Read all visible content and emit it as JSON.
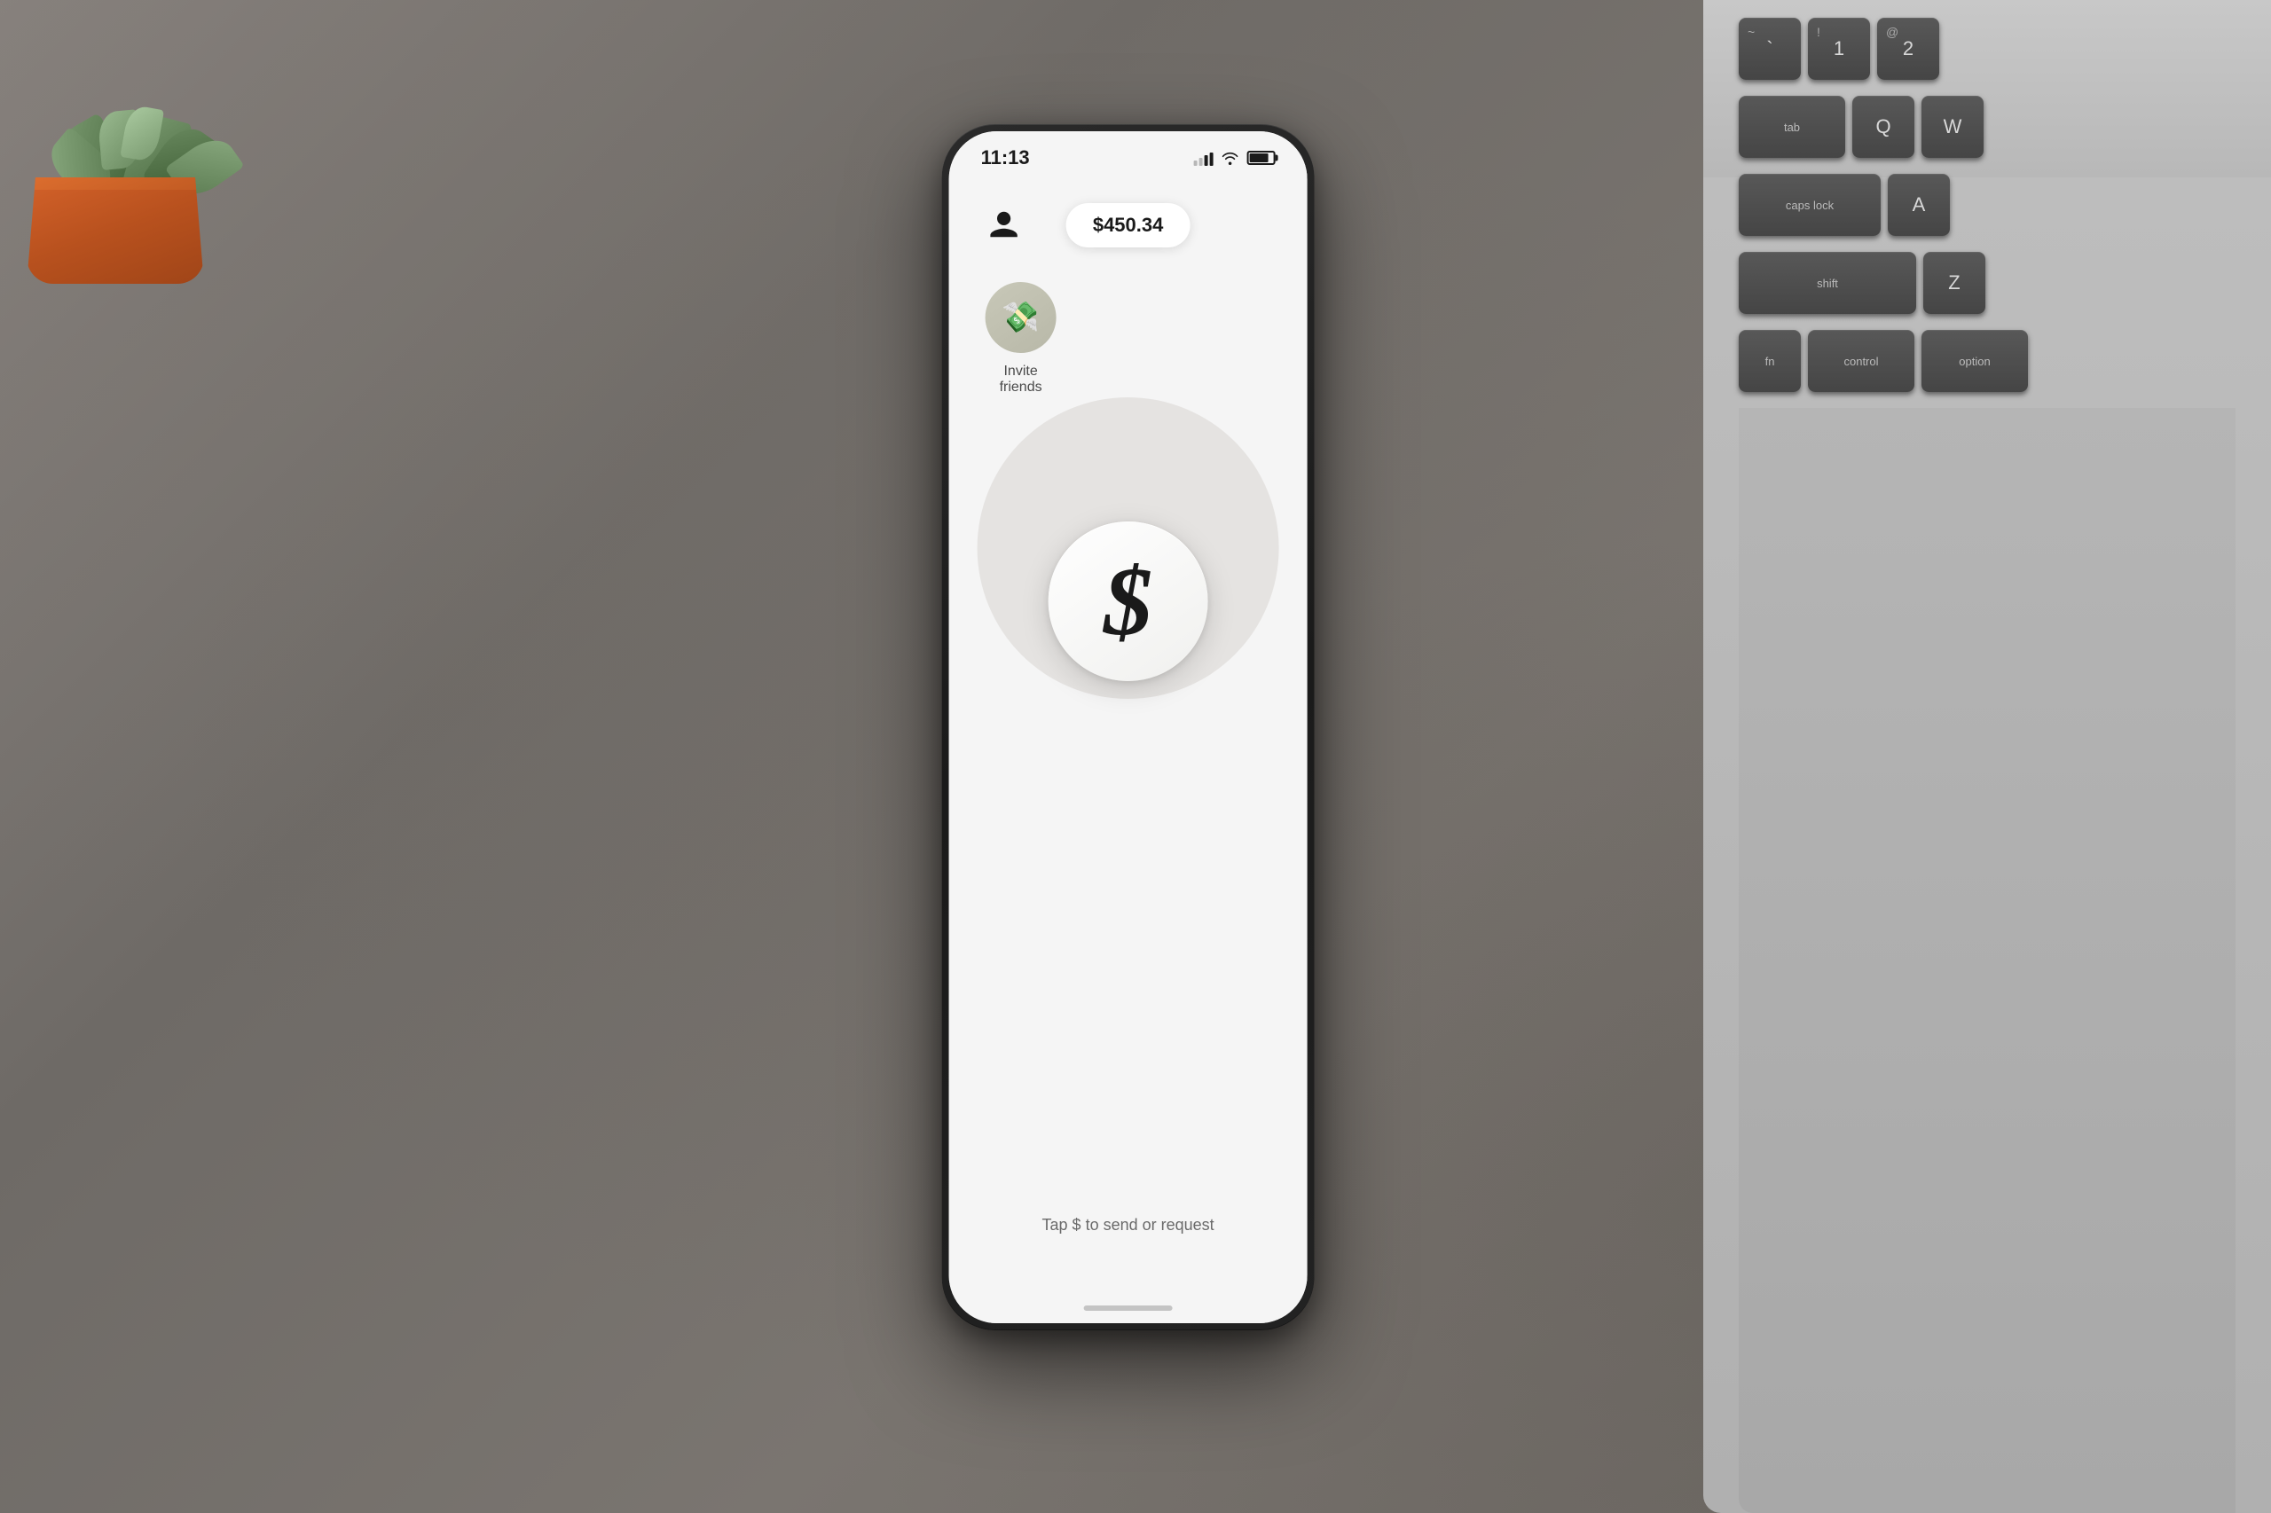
{
  "background": {
    "color": "#7a7570"
  },
  "phone": {
    "status_bar": {
      "time": "11:13",
      "signal_bars": 3,
      "wifi": true,
      "battery_percent": 75
    },
    "header": {
      "balance": "$450.34",
      "profile_icon": "person-icon"
    },
    "invite_friends": {
      "label": "Invite friends",
      "icon": "money-bag-emoji"
    },
    "dollar_button": {
      "symbol": "$",
      "hint": "Tap $ to send or request"
    }
  },
  "keyboard": {
    "rows": [
      {
        "keys": [
          {
            "top": "~",
            "main": "`",
            "label": ""
          },
          {
            "top": "!",
            "main": "1",
            "label": ""
          },
          {
            "top": "@",
            "main": "2",
            "label": ""
          }
        ]
      },
      {
        "keys": [
          {
            "main": "tab",
            "label": ""
          },
          {
            "main": "Q",
            "label": ""
          },
          {
            "main": "W",
            "label": ""
          }
        ]
      },
      {
        "keys": [
          {
            "main": "caps lock",
            "label": ""
          },
          {
            "main": "A",
            "label": ""
          }
        ]
      },
      {
        "keys": [
          {
            "main": "shift",
            "label": ""
          },
          {
            "main": "Z",
            "label": ""
          }
        ]
      },
      {
        "keys": [
          {
            "main": "fn",
            "label": ""
          },
          {
            "main": "control",
            "label": ""
          },
          {
            "main": "option",
            "label": ""
          }
        ]
      }
    ]
  }
}
